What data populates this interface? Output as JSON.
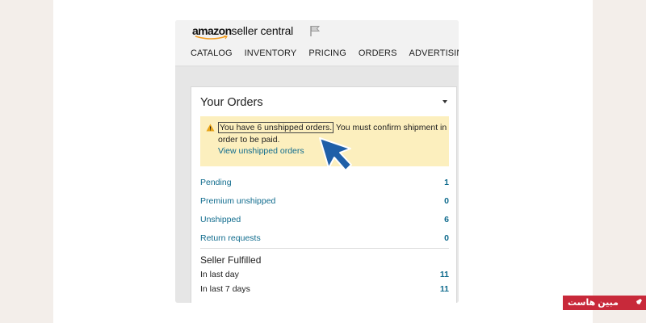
{
  "logo": {
    "brand": "amazon",
    "product": "seller central"
  },
  "nav": {
    "items": [
      "CATALOG",
      "INVENTORY",
      "PRICING",
      "ORDERS",
      "ADVERTISING"
    ]
  },
  "orders_card": {
    "title": "Your Orders",
    "alert": {
      "highlighted": "You have 6 unshipped orders.",
      "message": " You must confirm shipment in order to be paid.",
      "link": "View unshipped orders",
      "color": "#fcefbe"
    },
    "rows": [
      {
        "label": "Pending",
        "value": "1"
      },
      {
        "label": "Premium unshipped",
        "value": "0"
      },
      {
        "label": "Unshipped",
        "value": "6"
      },
      {
        "label": "Return requests",
        "value": "0"
      }
    ],
    "fulfilled": {
      "title": "Seller Fulfilled",
      "rows": [
        {
          "label": "In last day",
          "value": "11"
        },
        {
          "label": "In last 7 days",
          "value": "11"
        }
      ]
    }
  },
  "watermark": {
    "text": "مبین هاست"
  },
  "colors": {
    "link": "#0f6b8d",
    "cursor": "#1f5fa8",
    "watermark_bg": "#c8293a"
  }
}
